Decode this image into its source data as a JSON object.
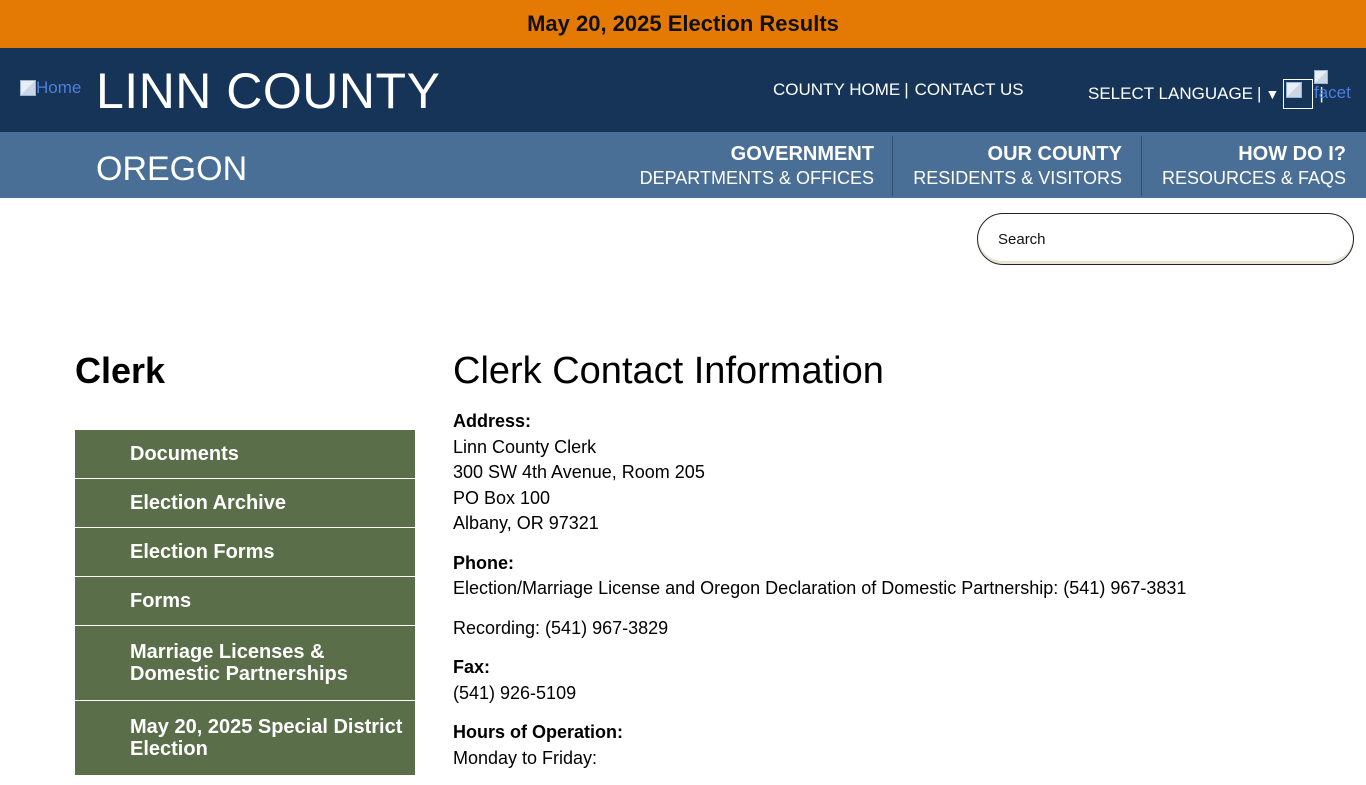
{
  "alert": {
    "link_text": "May 20, 2025 Election Results"
  },
  "header": {
    "home_alt": "Home",
    "site_title": "LINN COUNTY",
    "state": "OREGON",
    "util_links": [
      "COUNTY HOME",
      "CONTACT US"
    ],
    "util_sep": "|",
    "language_label": "SELECT LANGUAGE",
    "language_bar": "|",
    "facet_alt": "facet"
  },
  "nav": [
    {
      "title": "GOVERNMENT",
      "subtitle": "DEPARTMENTS & OFFICES"
    },
    {
      "title": "OUR COUNTY",
      "subtitle": "RESIDENTS & VISITORS"
    },
    {
      "title": "HOW DO I?",
      "subtitle": "RESOURCES & FAQS"
    }
  ],
  "search": {
    "placeholder": "Search"
  },
  "sidebar": {
    "heading": "Clerk",
    "items": [
      {
        "label": "Documents"
      },
      {
        "label": "Election Archive"
      },
      {
        "label": "Election Forms"
      },
      {
        "label": "Forms"
      },
      {
        "label": "Marriage Licenses & Domestic Partnerships"
      },
      {
        "label": "May 20, 2025 Special District Election"
      }
    ]
  },
  "content": {
    "title": "Clerk Contact Information",
    "address": {
      "label": "Address:",
      "lines": [
        "Linn County Clerk",
        "300 SW 4th Avenue, Room 205",
        "PO Box 100",
        "Albany, OR 97321"
      ]
    },
    "phone": {
      "label": "Phone:",
      "election": "Election/Marriage License and Oregon Declaration of Domestic Partnership: (541) 967-3831",
      "recording": "Recording: (541) 967-3829"
    },
    "fax": {
      "label": "Fax:",
      "number": "(541) 926-5109"
    },
    "hours": {
      "label": "Hours of Operation:",
      "line1": "Monday to Friday:"
    }
  }
}
